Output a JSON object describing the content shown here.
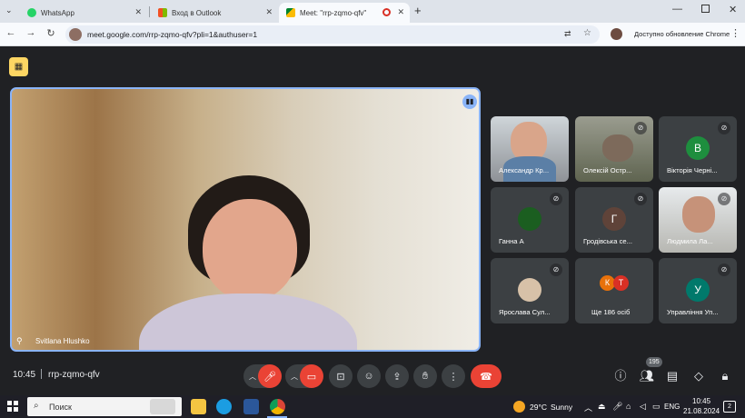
{
  "tabs": [
    {
      "title": "WhatsApp",
      "icon": "whatsapp-icon",
      "active": false
    },
    {
      "title": "Вход в Outlook",
      "icon": "microsoft-icon",
      "active": false
    },
    {
      "title": "Meet: \"rrp-zqmo-qfv\"",
      "icon": "meet-icon",
      "active": true
    }
  ],
  "address_bar": {
    "url": "meet.google.com/rrp-zqmo-qfv?pli=1&authuser=1",
    "update_label": "Доступно обновление Chrome"
  },
  "main_speaker": {
    "name": "Svitlana Hlushko"
  },
  "participants": [
    {
      "name": "Александр Кр...",
      "type": "video",
      "muted": false
    },
    {
      "name": "Олексій Остр...",
      "type": "video",
      "muted": true
    },
    {
      "name": "Вікторія Черні...",
      "type": "avatar",
      "initial": "В",
      "color": "#1e8e3e",
      "muted": true
    },
    {
      "name": "Ганна А",
      "type": "photo",
      "muted": true
    },
    {
      "name": "Гродівська се...",
      "type": "avatar",
      "initial": "Г",
      "color": "#5f4339",
      "muted": true
    },
    {
      "name": "Людмила Ла...",
      "type": "video",
      "muted": true
    },
    {
      "name": "Ярослава Сул...",
      "type": "photo",
      "muted": true
    },
    {
      "name": "Ще 186 осіб",
      "type": "group",
      "initials": [
        "К",
        "Т"
      ],
      "muted": true
    },
    {
      "name": "Управління Уп...",
      "type": "avatar",
      "initial": "У",
      "color": "#00796b",
      "muted": true
    }
  ],
  "meeting": {
    "time": "10:45",
    "code": "rrp-zqmo-qfv",
    "people_count": "195"
  },
  "taskbar": {
    "search_placeholder": "Поиск",
    "weather_temp": "29°C",
    "weather_desc": "Sunny",
    "lang": "ENG",
    "clock_time": "10:45",
    "clock_date": "21.08.2024",
    "notifications": "2"
  },
  "colors": {
    "accent": "#8ab4f8",
    "end_call": "#ea4335",
    "meet_bg": "#202124"
  }
}
